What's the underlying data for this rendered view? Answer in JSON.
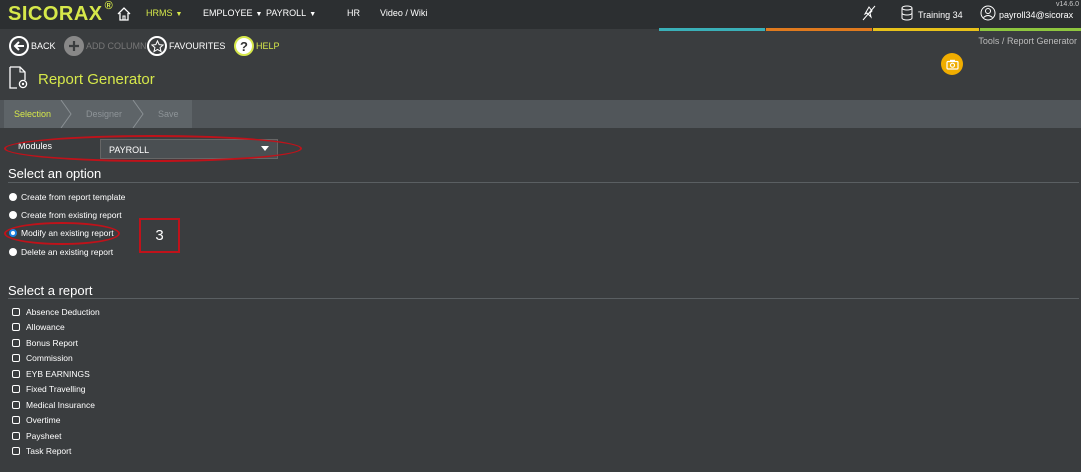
{
  "app": {
    "logo": "SICORAX",
    "logo_reg": "®",
    "version": "v14.6.0"
  },
  "nav": {
    "items": [
      {
        "label": "HRMS"
      },
      {
        "label": "EMPLOYEE"
      },
      {
        "label": "PAYROLL"
      },
      {
        "label": "HR"
      },
      {
        "label": "Video / Wiki"
      }
    ],
    "caret": "▼"
  },
  "topright": {
    "training": "Training 34",
    "user": "payroll34@sicorax"
  },
  "colors": {
    "accent": "#d6e84a",
    "bar": [
      "#3ab0b8",
      "#e07a1e",
      "#e8c21a",
      "#8ec63f"
    ]
  },
  "toolbar": {
    "back": "BACK",
    "add_column": "ADD COLUMN",
    "favourites": "FAVOURITES",
    "help": "HELP",
    "help_glyph": "?"
  },
  "breadcrumb": {
    "parent": "Tools /",
    "current": "Report Generator"
  },
  "page": {
    "title": "Report Generator"
  },
  "wizard": {
    "steps": [
      {
        "label": "Selection",
        "active": true
      },
      {
        "label": "Designer",
        "active": false
      },
      {
        "label": "Save",
        "active": false
      }
    ]
  },
  "modules": {
    "label": "Modules",
    "selected": "PAYROLL"
  },
  "options": {
    "title": "Select an option",
    "items": [
      {
        "label": "Create from report template",
        "checked": false
      },
      {
        "label": "Create from existing report",
        "checked": false
      },
      {
        "label": "Modify an existing report",
        "checked": true
      },
      {
        "label": "Delete an existing report",
        "checked": false
      }
    ]
  },
  "reports": {
    "title": "Select a report",
    "items": [
      "Absence Deduction",
      "Allowance",
      "Bonus Report",
      "Commission",
      "EYB EARNINGS",
      "Fixed Travelling",
      "Medical Insurance",
      "Overtime",
      "Paysheet",
      "Task Report"
    ]
  },
  "annotation": {
    "step_number": "3"
  }
}
